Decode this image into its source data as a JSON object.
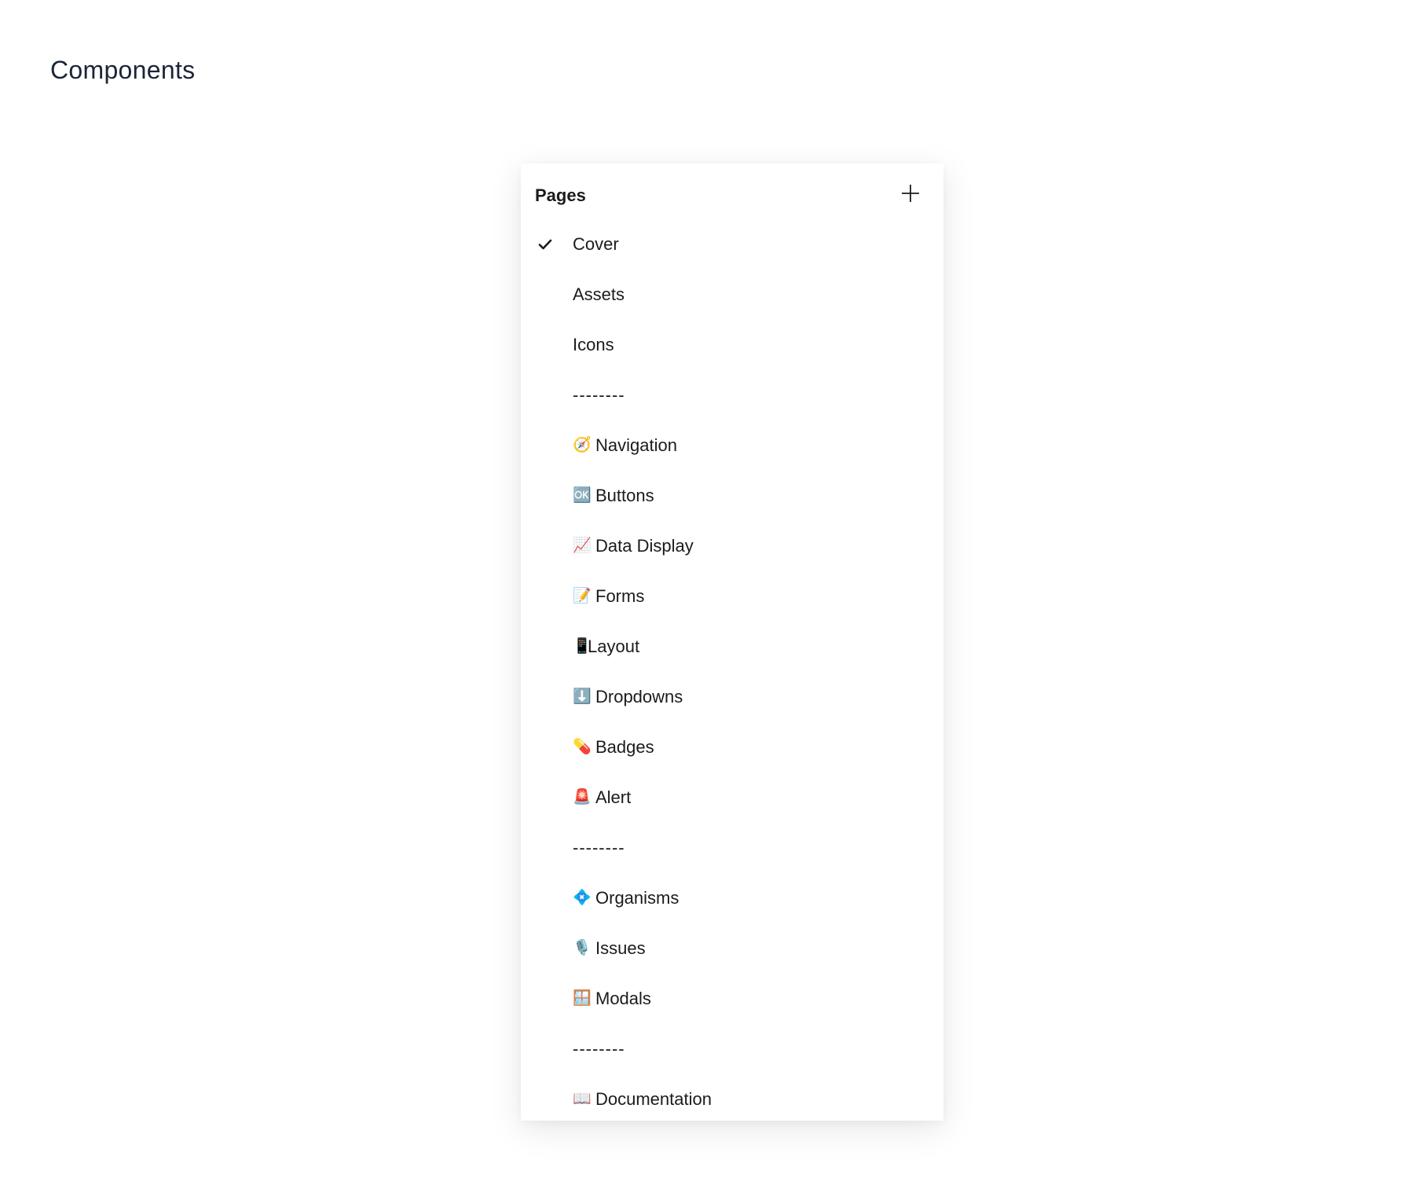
{
  "page": {
    "title": "Components"
  },
  "pages_panel": {
    "title": "Pages",
    "add_icon": "plus-icon",
    "items": [
      {
        "label": "Cover",
        "emoji": "",
        "icon": "",
        "active": true,
        "type": "page"
      },
      {
        "label": "Assets",
        "emoji": "",
        "icon": "",
        "active": false,
        "type": "page"
      },
      {
        "label": "Icons",
        "emoji": "",
        "icon": "",
        "active": false,
        "type": "page"
      },
      {
        "label": "--------",
        "emoji": "",
        "icon": "",
        "active": false,
        "type": "separator"
      },
      {
        "label": "Navigation",
        "emoji": "🧭",
        "icon": "compass-icon",
        "active": false,
        "type": "page"
      },
      {
        "label": "Buttons",
        "emoji": "🆗",
        "icon": "ok-button-icon",
        "active": false,
        "type": "page"
      },
      {
        "label": "Data Display",
        "emoji": "📈",
        "icon": "chart-increasing-icon",
        "active": false,
        "type": "page"
      },
      {
        "label": "Forms",
        "emoji": "📝",
        "icon": "memo-icon",
        "active": false,
        "type": "page"
      },
      {
        "label": "Layout",
        "emoji": "📱",
        "icon": "mobile-phone-icon",
        "active": false,
        "type": "page",
        "tight": true
      },
      {
        "label": "Dropdowns",
        "emoji": "⬇️",
        "icon": "down-arrow-icon",
        "active": false,
        "type": "page"
      },
      {
        "label": "Badges",
        "emoji": "💊",
        "icon": "pill-icon",
        "active": false,
        "type": "page"
      },
      {
        "label": "Alert",
        "emoji": "🚨",
        "icon": "siren-icon",
        "active": false,
        "type": "page"
      },
      {
        "label": "--------",
        "emoji": "",
        "icon": "",
        "active": false,
        "type": "separator"
      },
      {
        "label": "Organisms",
        "emoji": "💠",
        "icon": "diamond-icon",
        "active": false,
        "type": "page"
      },
      {
        "label": "Issues",
        "emoji": "🎙️",
        "icon": "microphone-icon",
        "active": false,
        "type": "page"
      },
      {
        "label": "Modals",
        "emoji": "🪟",
        "icon": "window-icon",
        "active": false,
        "type": "page"
      },
      {
        "label": "--------",
        "emoji": "",
        "icon": "",
        "active": false,
        "type": "separator"
      },
      {
        "label": "Documentation",
        "emoji": "📖",
        "icon": "open-book-icon",
        "active": false,
        "type": "page"
      }
    ]
  }
}
